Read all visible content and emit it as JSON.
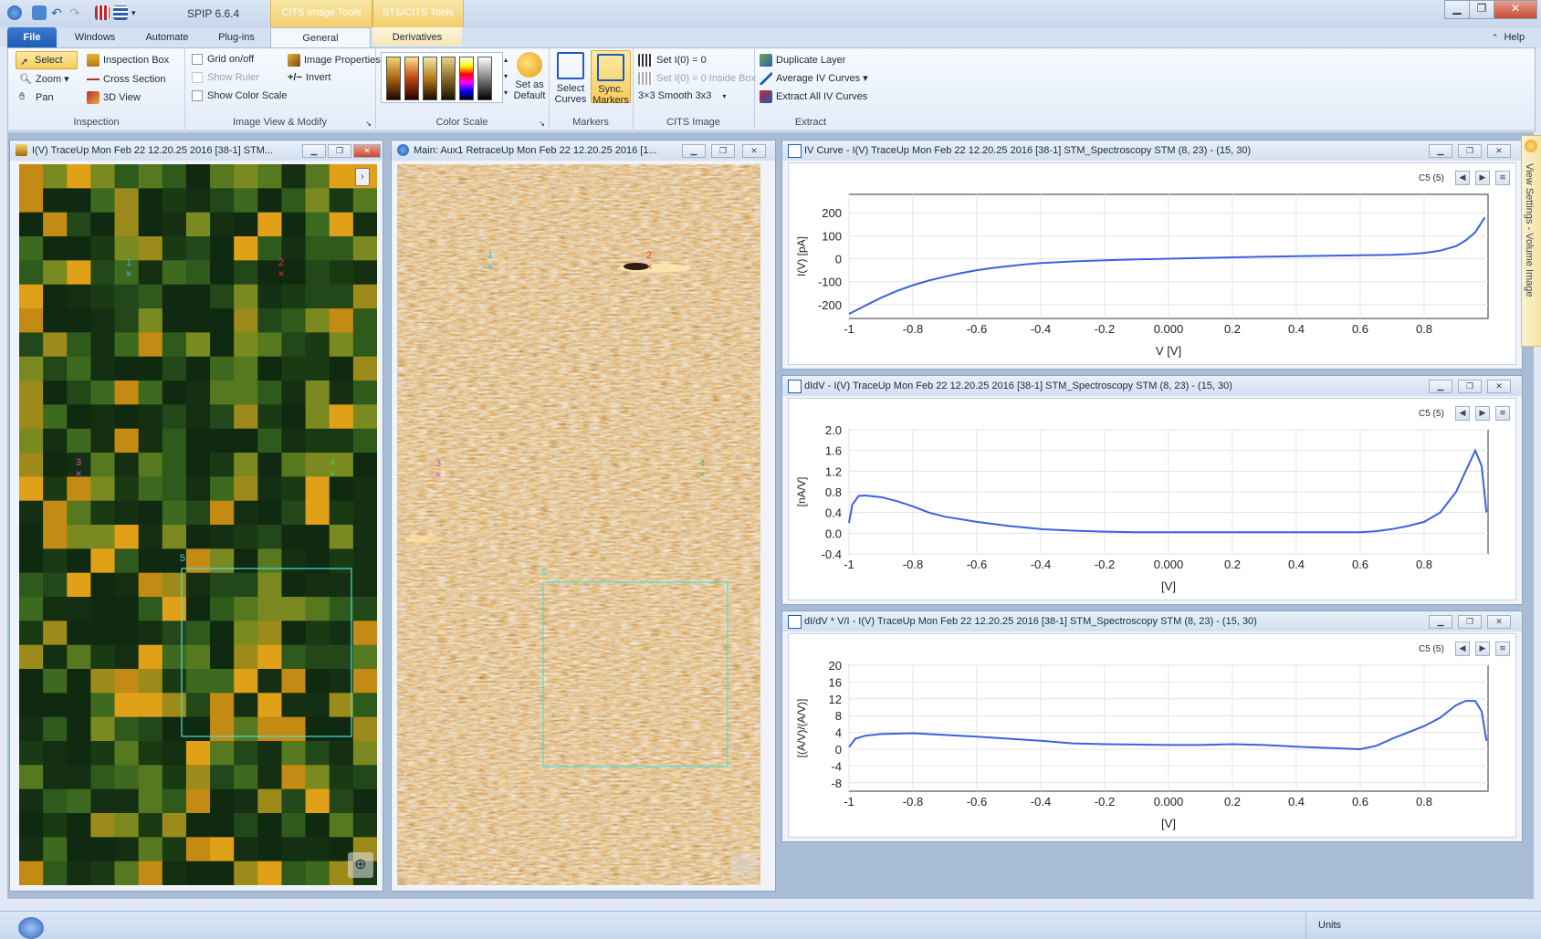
{
  "app": {
    "title": "SPIP 6.6.4"
  },
  "context_tabs": {
    "cits_tools": "CITS Image Tools",
    "sts_tools": "STS/CITS Tools"
  },
  "tabs": {
    "file": "File",
    "windows": "Windows",
    "automate": "Automate",
    "plugins": "Plug-ins",
    "general": "General",
    "derivatives": "Derivatives",
    "help": "Help"
  },
  "ribbon": {
    "inspection": {
      "title": "Inspection",
      "select": "Select",
      "zoom": "Zoom",
      "pan": "Pan",
      "inspection_box": "Inspection Box",
      "cross_section": "Cross Section",
      "view3d": "3D View"
    },
    "view_modify": {
      "title": "Image View & Modify",
      "grid": "Grid on/off",
      "show_ruler": "Show Ruler",
      "show_color_scale": "Show Color Scale",
      "image_properties": "Image Properties",
      "invert": "Invert"
    },
    "color_scale": {
      "title": "Color Scale",
      "set_default_1": "Set as",
      "set_default_2": "Default"
    },
    "markers": {
      "title": "Markers",
      "select_curves_1": "Select",
      "select_curves_2": "Curves",
      "sync_1": "Sync.",
      "sync_2": "Markers"
    },
    "cits": {
      "title": "CITS Image",
      "set_i0": "Set I(0) = 0",
      "set_i0_box": "Set I(0) = 0 Inside Box",
      "smooth": "Smooth 3x3",
      "smooth_icon": "3×3"
    },
    "extract": {
      "title": "Extract",
      "duplicate": "Duplicate Layer",
      "average": "Average IV Curves",
      "extract_all": "Extract All IV Curves"
    }
  },
  "panels": {
    "left": {
      "title": "I(V) TraceUp Mon Feb 22 12.20.25 2016 [38-1]  STM..."
    },
    "main": {
      "title": "Main: Aux1 RetraceUp Mon Feb 22 12.20.25 2016 [1..."
    },
    "iv": {
      "title": "IV Curve - I(V) TraceUp Mon Feb 22 12.20.25 2016 [38-1]  STM_Spectroscopy STM (8, 23) - (15, 30)",
      "curve_label": "C5 (5)"
    },
    "didv": {
      "title": "dIdV - I(V) TraceUp Mon Feb 22 12.20.25 2016 [38-1]  STM_Spectroscopy STM (8, 23) - (15, 30)",
      "curve_label": "C5 (5)"
    },
    "norm": {
      "title": "dI/dV * V/I - I(V) TraceUp Mon Feb 22 12.20.25 2016 [38-1]  STM_Spectroscopy STM (8, 23) - (15, 30)",
      "curve_label": "C5 (5)"
    }
  },
  "markers": {
    "m1": "1",
    "m2": "2",
    "m3": "3",
    "m4": "4",
    "m5": "5"
  },
  "status": {
    "units": "Units"
  },
  "side": {
    "label": "View Settings - Volume Image"
  },
  "chart_data": [
    {
      "type": "line",
      "xlabel": "V [V]",
      "ylabel": "I(V) [pA]",
      "xlim": [
        -1,
        1
      ],
      "ylim": [
        -260,
        280
      ],
      "xticks": [
        "-1",
        "-0.8",
        "-0.6",
        "-0.4",
        "-0.2",
        "0.000",
        "0.2",
        "0.4",
        "0.6",
        "0.8"
      ],
      "yticks": [
        "200",
        "100",
        "0",
        "-100",
        "-200"
      ],
      "x": [
        -1.0,
        -0.95,
        -0.9,
        -0.85,
        -0.8,
        -0.75,
        -0.7,
        -0.65,
        -0.6,
        -0.55,
        -0.5,
        -0.45,
        -0.4,
        -0.3,
        -0.2,
        -0.1,
        0.0,
        0.1,
        0.2,
        0.3,
        0.4,
        0.5,
        0.6,
        0.7,
        0.75,
        0.8,
        0.85,
        0.9,
        0.93,
        0.96,
        0.99
      ],
      "y": [
        -240,
        -205,
        -170,
        -140,
        -115,
        -95,
        -78,
        -63,
        -50,
        -40,
        -32,
        -25,
        -19,
        -12,
        -7,
        -3,
        0,
        3,
        6,
        9,
        11,
        13,
        15,
        17,
        20,
        25,
        35,
        55,
        80,
        115,
        180
      ]
    },
    {
      "type": "line",
      "xlabel": "[V]",
      "ylabel": "[nA/V]",
      "xlim": [
        -1,
        1
      ],
      "ylim": [
        -0.4,
        2.0
      ],
      "xticks": [
        "-1",
        "-0.8",
        "-0.6",
        "-0.4",
        "-0.2",
        "0.000",
        "0.2",
        "0.4",
        "0.6",
        "0.8"
      ],
      "yticks": [
        "2.0",
        "1.6",
        "1.2",
        "0.8",
        "0.4",
        "0.0",
        "-0.4"
      ],
      "x": [
        -1.0,
        -0.99,
        -0.97,
        -0.95,
        -0.9,
        -0.85,
        -0.8,
        -0.75,
        -0.7,
        -0.6,
        -0.5,
        -0.4,
        -0.3,
        -0.2,
        -0.1,
        0.0,
        0.1,
        0.2,
        0.3,
        0.4,
        0.5,
        0.6,
        0.65,
        0.7,
        0.75,
        0.8,
        0.85,
        0.9,
        0.93,
        0.96,
        0.98,
        0.995
      ],
      "y": [
        0.2,
        0.55,
        0.72,
        0.73,
        0.7,
        0.62,
        0.52,
        0.4,
        0.32,
        0.22,
        0.14,
        0.08,
        0.05,
        0.03,
        0.02,
        0.02,
        0.02,
        0.02,
        0.02,
        0.02,
        0.02,
        0.02,
        0.04,
        0.08,
        0.14,
        0.22,
        0.4,
        0.8,
        1.2,
        1.6,
        1.3,
        0.4
      ]
    },
    {
      "type": "line",
      "xlabel": "[V]",
      "ylabel": "[(A/V)/(A/V)]",
      "xlim": [
        -1,
        1
      ],
      "ylim": [
        -10,
        20
      ],
      "xticks": [
        "-1",
        "-0.8",
        "-0.6",
        "-0.4",
        "-0.2",
        "0.000",
        "0.2",
        "0.4",
        "0.6",
        "0.8"
      ],
      "yticks": [
        "20",
        "16",
        "12",
        "8",
        "4",
        "0",
        "-4",
        "-8"
      ],
      "x": [
        -1.0,
        -0.98,
        -0.95,
        -0.9,
        -0.8,
        -0.7,
        -0.6,
        -0.5,
        -0.4,
        -0.3,
        -0.2,
        -0.1,
        0.0,
        0.1,
        0.2,
        0.3,
        0.4,
        0.5,
        0.6,
        0.65,
        0.7,
        0.75,
        0.8,
        0.85,
        0.9,
        0.93,
        0.96,
        0.98,
        0.995
      ],
      "y": [
        0.5,
        2.5,
        3.2,
        3.6,
        3.8,
        3.4,
        3.0,
        2.5,
        2.0,
        1.4,
        1.2,
        1.1,
        1.0,
        1.0,
        1.2,
        1.0,
        0.6,
        0.3,
        0.0,
        0.8,
        2.5,
        4.0,
        5.5,
        7.5,
        10.5,
        11.5,
        11.5,
        9.0,
        2.0
      ]
    }
  ]
}
